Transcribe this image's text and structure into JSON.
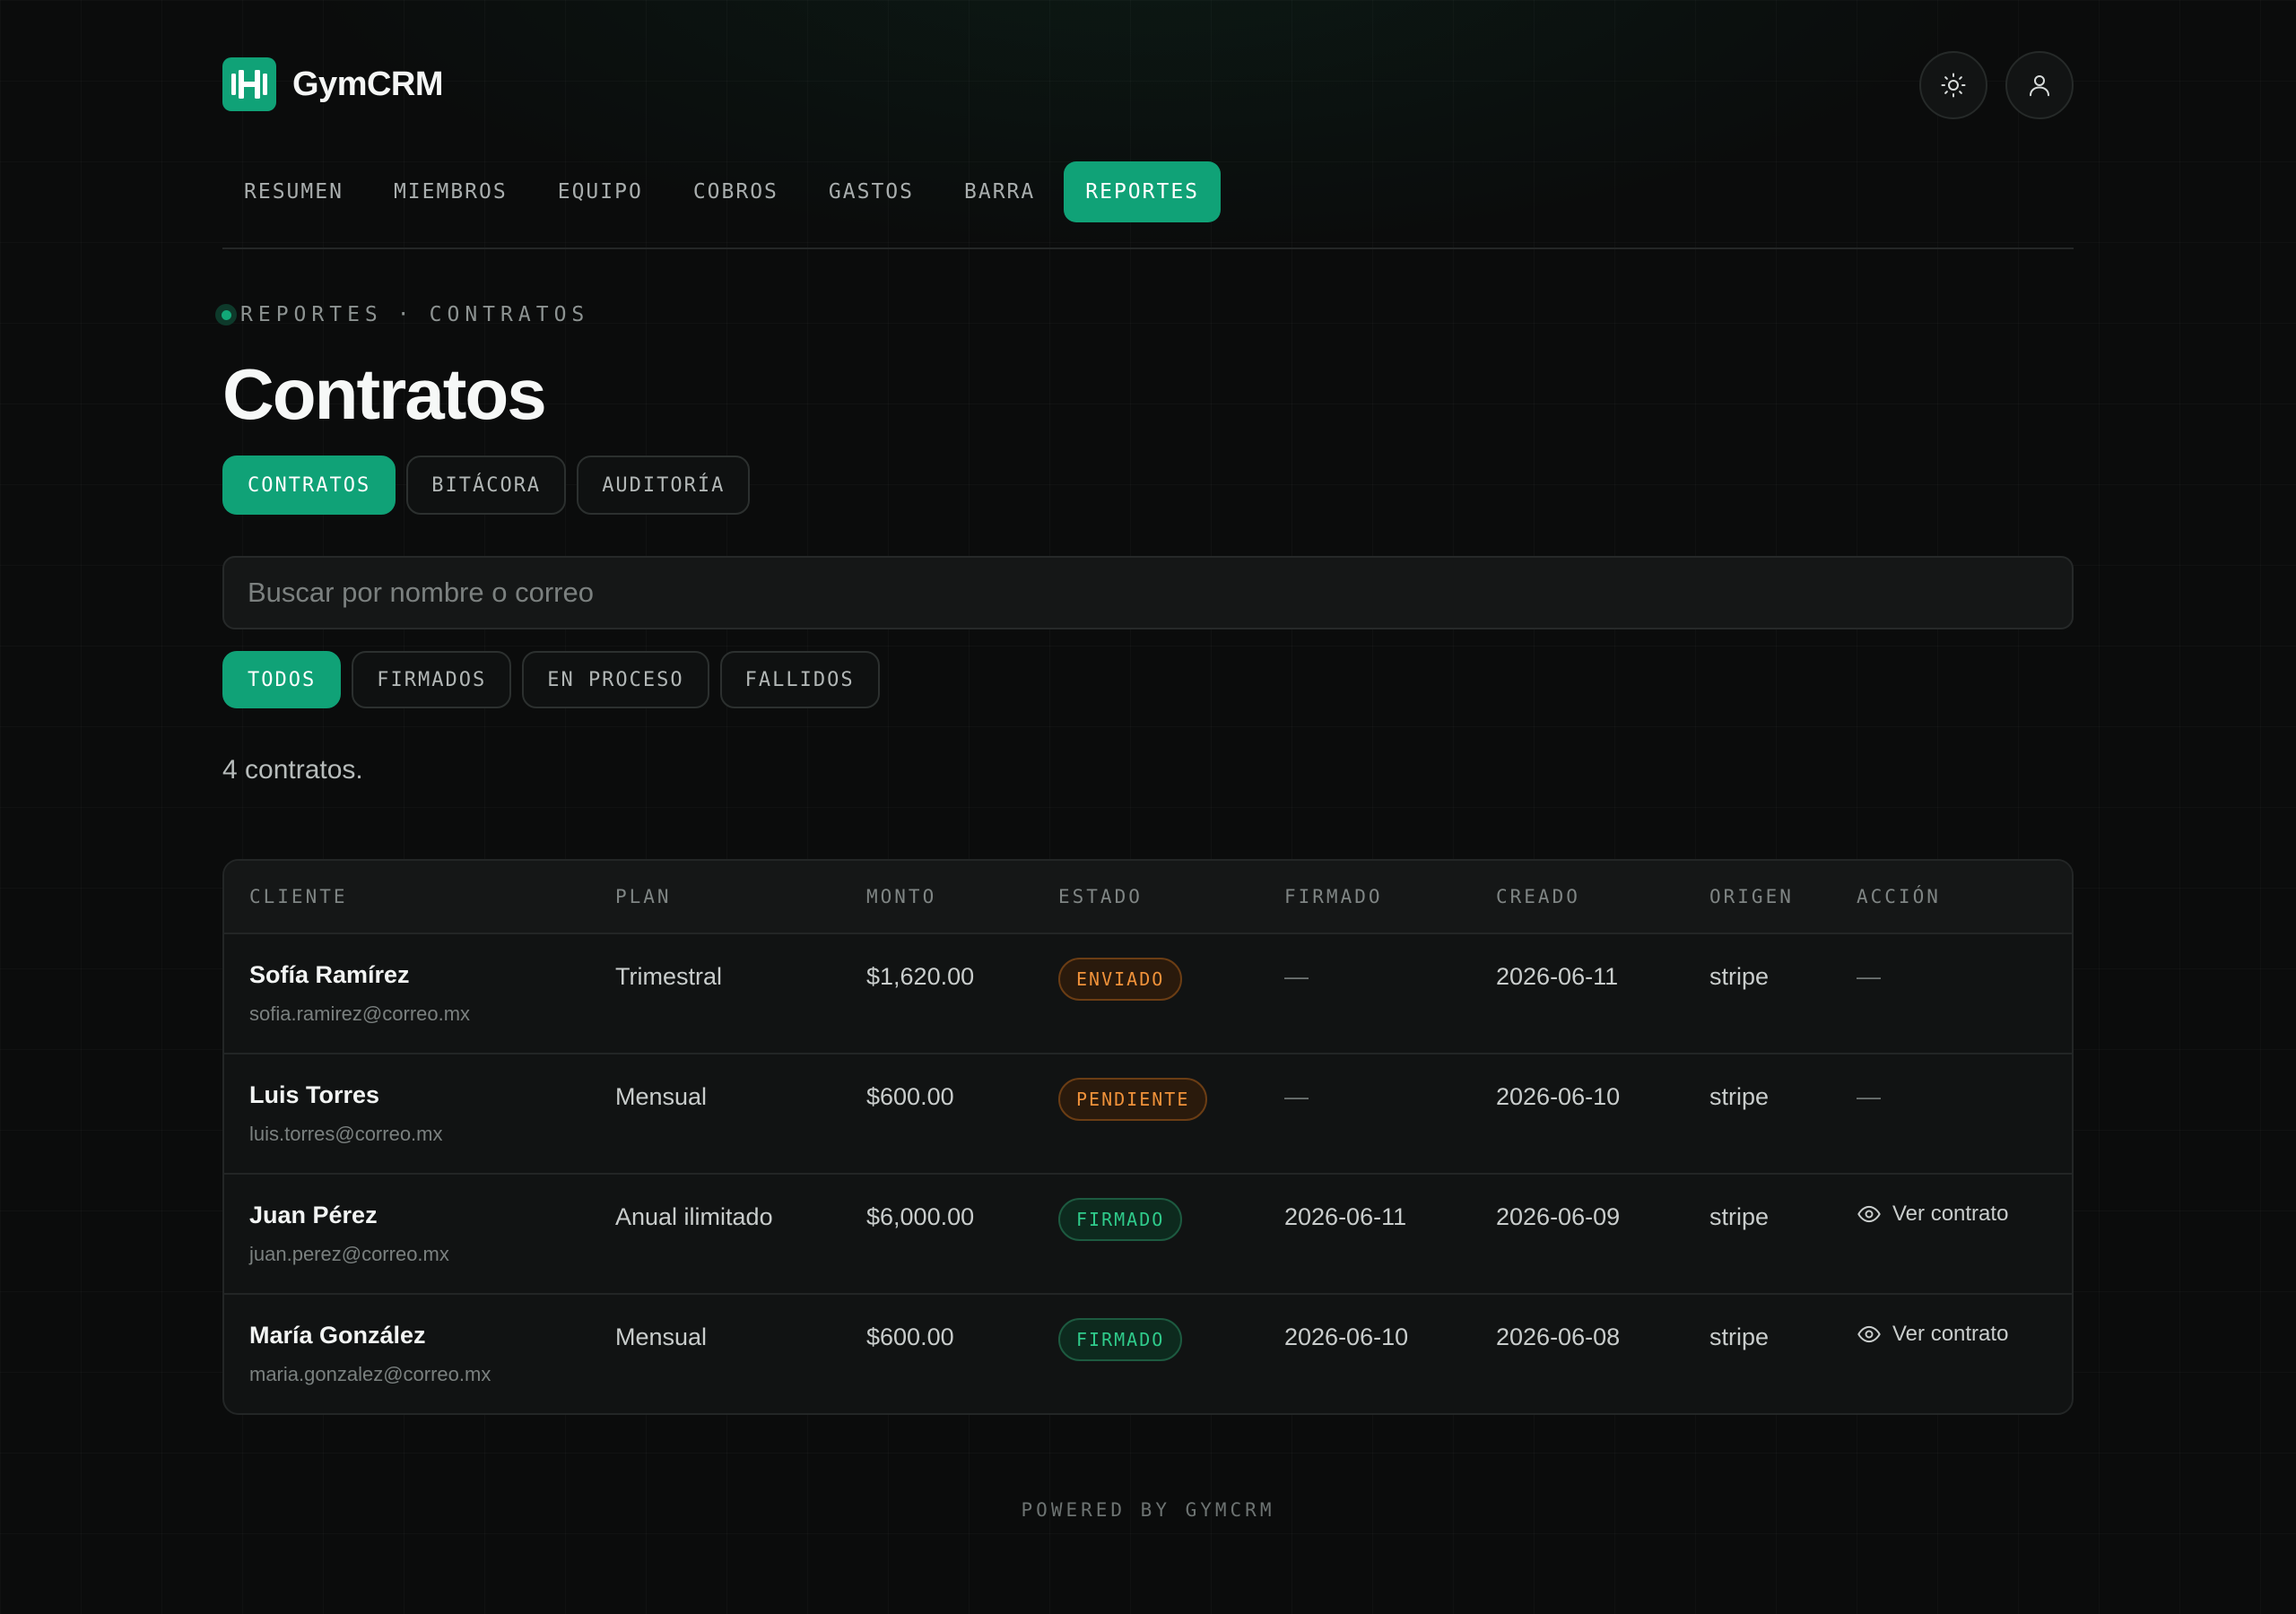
{
  "app": {
    "name": "GymCRM"
  },
  "header": {
    "theme_icon": "sun-icon",
    "user_icon": "user-icon"
  },
  "nav": {
    "items": [
      "RESUMEN",
      "MIEMBROS",
      "EQUIPO",
      "COBROS",
      "GASTOS",
      "BARRA",
      "REPORTES"
    ],
    "active": "REPORTES"
  },
  "breadcrumb": {
    "section": "REPORTES",
    "separator": "·",
    "page": "CONTRATOS"
  },
  "page": {
    "title": "Contratos"
  },
  "subtabs": {
    "items": [
      "CONTRATOS",
      "BITÁCORA",
      "AUDITORÍA"
    ],
    "active": "CONTRATOS"
  },
  "search": {
    "placeholder": "Buscar por nombre o correo",
    "value": ""
  },
  "filters": {
    "items": [
      "TODOS",
      "FIRMADOS",
      "EN PROCESO",
      "FALLIDOS"
    ],
    "active": "TODOS"
  },
  "summary": {
    "count_text": "4 contratos."
  },
  "table": {
    "columns": [
      "CLIENTE",
      "PLAN",
      "MONTO",
      "ESTADO",
      "FIRMADO",
      "CREADO",
      "ORIGEN",
      "ACCIÓN"
    ],
    "rows": [
      {
        "name": "Sofía Ramírez",
        "email": "sofia.ramirez@correo.mx",
        "plan": "Trimestral",
        "amount": "$1,620.00",
        "status": "ENVIADO",
        "status_color": "#f0923a",
        "signed": "—",
        "created": "2026-06-11",
        "origin": "stripe",
        "action": "—"
      },
      {
        "name": "Luis Torres",
        "email": "luis.torres@correo.mx",
        "plan": "Mensual",
        "amount": "$600.00",
        "status": "PENDIENTE",
        "status_color": "#f0923a",
        "signed": "—",
        "created": "2026-06-10",
        "origin": "stripe",
        "action": "—"
      },
      {
        "name": "Juan Pérez",
        "email": "juan.perez@correo.mx",
        "plan": "Anual ilimitado",
        "amount": "$6,000.00",
        "status": "FIRMADO",
        "status_color": "#2fcb8b",
        "signed": "2026-06-11",
        "created": "2026-06-09",
        "origin": "stripe",
        "action": "Ver contrato",
        "action_icon": "eye-icon"
      },
      {
        "name": "María González",
        "email": "maria.gonzalez@correo.mx",
        "plan": "Mensual",
        "amount": "$600.00",
        "status": "FIRMADO",
        "status_color": "#2fcb8b",
        "signed": "2026-06-10",
        "created": "2026-06-08",
        "origin": "stripe",
        "action": "Ver contrato",
        "action_icon": "eye-icon"
      }
    ]
  },
  "footer": {
    "text": "POWERED BY GYMCRM"
  },
  "colors": {
    "accent": "#10a277",
    "warning": "#f0923a",
    "success": "#2fcb8b",
    "background": "#0b0c0c"
  }
}
